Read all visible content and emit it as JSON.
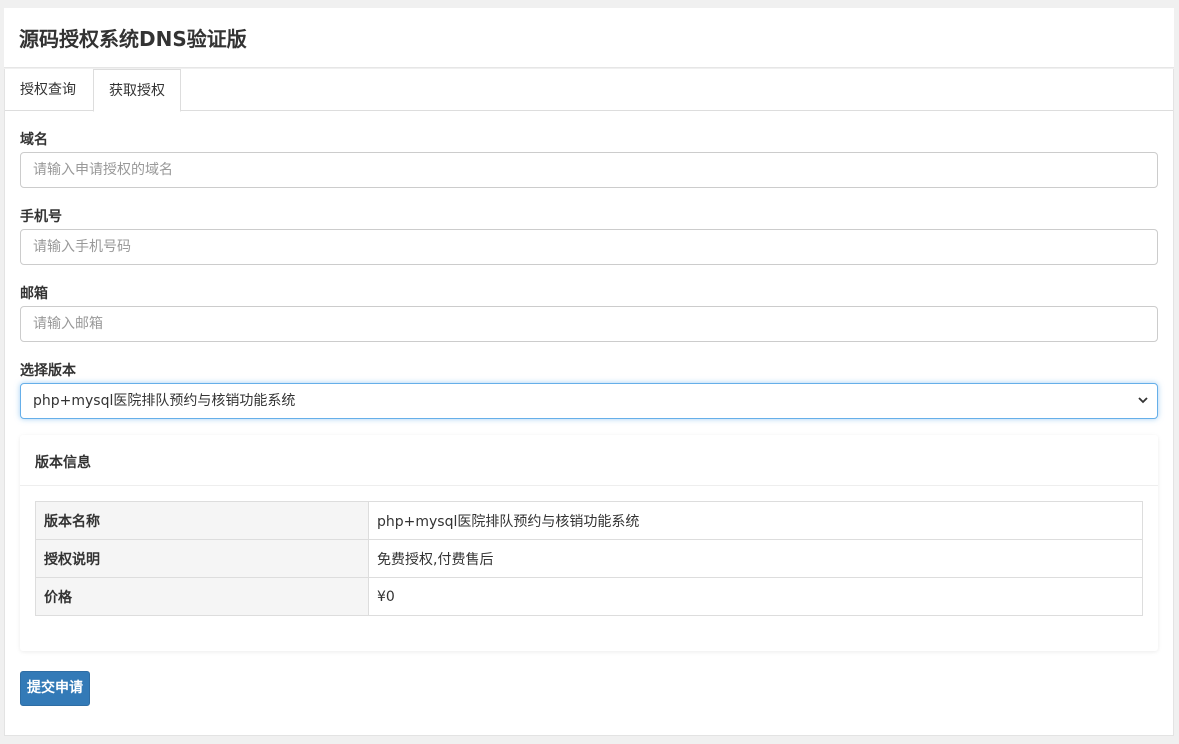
{
  "header": {
    "title": "源码授权系统DNS验证版"
  },
  "tabs": [
    {
      "label": "授权查询",
      "active": false
    },
    {
      "label": "获取授权",
      "active": true
    }
  ],
  "form": {
    "domain": {
      "label": "域名",
      "placeholder": "请输入申请授权的域名",
      "value": ""
    },
    "phone": {
      "label": "手机号",
      "placeholder": "请输入手机号码",
      "value": ""
    },
    "email": {
      "label": "邮箱",
      "placeholder": "请输入邮箱",
      "value": ""
    },
    "version": {
      "label": "选择版本",
      "selected": "php+mysql医院排队预约与核销功能系统"
    }
  },
  "version_info": {
    "title": "版本信息",
    "rows": [
      {
        "key": "版本名称",
        "value": "php+mysql医院排队预约与核销功能系统"
      },
      {
        "key": "授权说明",
        "value": "免费授权,付费售后"
      },
      {
        "key": "价格",
        "value": "¥0"
      }
    ]
  },
  "submit": {
    "label": "提交申请"
  },
  "colors": {
    "primary": "#337ab7",
    "focus_border": "#66afe9"
  },
  "icons": {
    "select_chevron": "chevron-down-icon"
  }
}
